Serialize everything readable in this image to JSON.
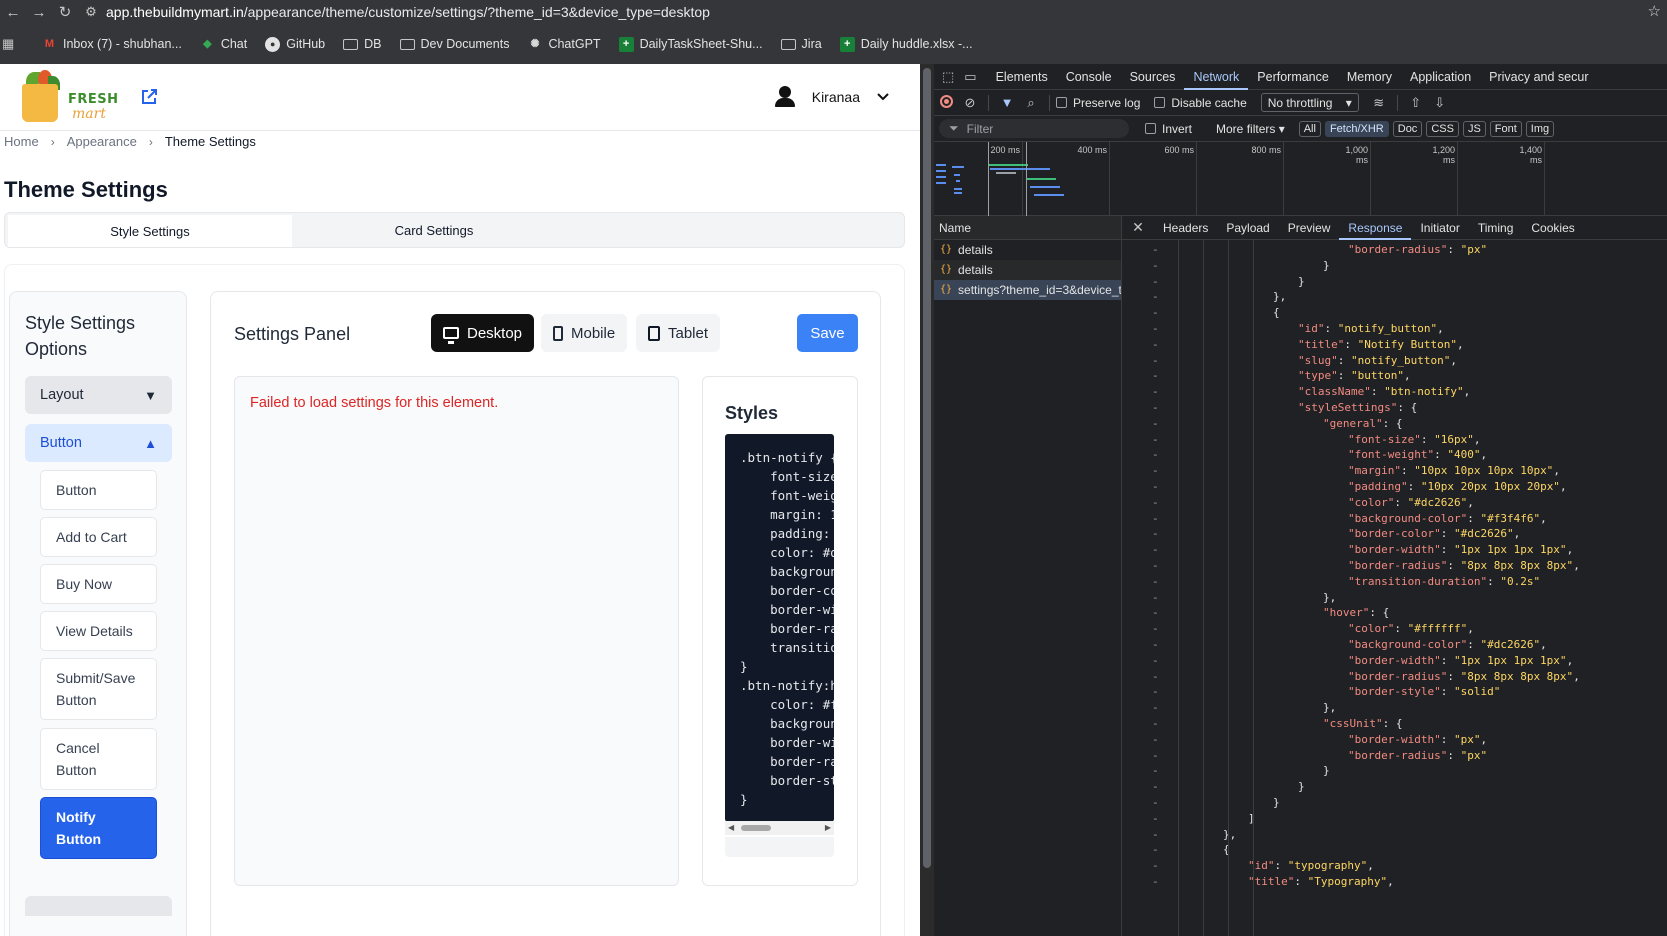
{
  "browser": {
    "url_host": "app.thebuildmymart.in",
    "url_path": "/appearance/theme/customize/settings/?theme_id=3&device_type=desktop",
    "bookmarks": [
      {
        "label": "Inbox (7) - shubhan...",
        "icon": "gmail-icon"
      },
      {
        "label": "Chat",
        "icon": "chat-icon"
      },
      {
        "label": "GitHub",
        "icon": "github-icon"
      },
      {
        "label": "DB",
        "icon": "folder-icon"
      },
      {
        "label": "Dev Documents",
        "icon": "folder-icon"
      },
      {
        "label": "ChatGPT",
        "icon": "chatgpt-icon"
      },
      {
        "label": "DailyTaskSheet-Shu...",
        "icon": "sheets-icon"
      },
      {
        "label": "Jira",
        "icon": "folder-icon"
      },
      {
        "label": "Daily huddle.xlsx -...",
        "icon": "sheets-icon"
      }
    ]
  },
  "app": {
    "logo_line1": "FRESH",
    "logo_line2": "mart",
    "user_name": "Kiranaa",
    "breadcrumb": [
      "Home",
      "Appearance",
      "Theme Settings"
    ],
    "page_title": "Theme Settings",
    "tabs": [
      "Style Settings",
      "Card Settings"
    ],
    "sidebar": {
      "title": "Style Settings Options",
      "sections": [
        {
          "label": "Layout",
          "expanded": false
        },
        {
          "label": "Button",
          "expanded": true
        }
      ],
      "items": [
        "Button",
        "Add to Cart",
        "Buy Now",
        "View Details",
        "Submit/Save Button",
        "Cancel Button",
        "Notify Button"
      ],
      "selected_item": "Notify Button"
    },
    "panel": {
      "title": "Settings Panel",
      "devices": [
        "Desktop",
        "Mobile",
        "Tablet"
      ],
      "active_device": "Desktop",
      "save_label": "Save",
      "error_message": "Failed to load settings for this element.",
      "styles_title": "Styles",
      "code_lines": [
        ".btn-notify {",
        "    font-size",
        "    font-weig",
        "    margin: 1",
        "    padding:",
        "    color: #d",
        "    backgroun",
        "    border-co",
        "    border-wi",
        "    border-ra",
        "    transitio",
        "}",
        ".btn-notify:h",
        "    color: #f",
        "    backgroun",
        "    border-wi",
        "    border-ra",
        "    border-st",
        "}"
      ]
    }
  },
  "devtools": {
    "main_tabs": [
      "Elements",
      "Console",
      "Sources",
      "Network",
      "Performance",
      "Memory",
      "Application",
      "Privacy and secur"
    ],
    "active_main_tab": "Network",
    "preserve_log": "Preserve log",
    "disable_cache": "Disable cache",
    "throttling": "No throttling",
    "filter_placeholder": "Filter",
    "invert": "Invert",
    "more_filters": "More filters",
    "type_filters": [
      "All",
      "Fetch/XHR",
      "Doc",
      "CSS",
      "JS",
      "Font",
      "Img"
    ],
    "active_type_filter": "Fetch/XHR",
    "timeline_labels": [
      "200 ms",
      "400 ms",
      "600 ms",
      "800 ms",
      "1,000 ms",
      "1,200 ms",
      "1,400 ms"
    ],
    "name_header": "Name",
    "requests": [
      "details",
      "details",
      "settings?theme_id=3&device_t..."
    ],
    "selected_request": "settings?theme_id=3&device_t...",
    "detail_tabs": [
      "Headers",
      "Payload",
      "Preview",
      "Response",
      "Initiator",
      "Timing",
      "Cookies"
    ],
    "active_detail_tab": "Response",
    "response_lines": [
      {
        "indent": 10,
        "text": "\"border-radius\": \"px\""
      },
      {
        "indent": 9,
        "text": "}"
      },
      {
        "indent": 8,
        "text": "}"
      },
      {
        "indent": 7,
        "text": "},"
      },
      {
        "indent": 7,
        "text": "{"
      },
      {
        "indent": 8,
        "text": "\"id\": \"notify_button\","
      },
      {
        "indent": 8,
        "text": "\"title\": \"Notify Button\","
      },
      {
        "indent": 8,
        "text": "\"slug\": \"notify_button\","
      },
      {
        "indent": 8,
        "text": "\"type\": \"button\","
      },
      {
        "indent": 8,
        "text": "\"className\": \"btn-notify\","
      },
      {
        "indent": 8,
        "text": "\"styleSettings\": {"
      },
      {
        "indent": 9,
        "text": "\"general\": {"
      },
      {
        "indent": 10,
        "text": "\"font-size\": \"16px\","
      },
      {
        "indent": 10,
        "text": "\"font-weight\": \"400\","
      },
      {
        "indent": 10,
        "text": "\"margin\": \"10px 10px 10px 10px\","
      },
      {
        "indent": 10,
        "text": "\"padding\": \"10px 20px 10px 20px\","
      },
      {
        "indent": 10,
        "text": "\"color\": \"#dc2626\","
      },
      {
        "indent": 10,
        "text": "\"background-color\": \"#f3f4f6\","
      },
      {
        "indent": 10,
        "text": "\"border-color\": \"#dc2626\","
      },
      {
        "indent": 10,
        "text": "\"border-width\": \"1px 1px 1px 1px\","
      },
      {
        "indent": 10,
        "text": "\"border-radius\": \"8px 8px 8px 8px\","
      },
      {
        "indent": 10,
        "text": "\"transition-duration\": \"0.2s\""
      },
      {
        "indent": 9,
        "text": "},"
      },
      {
        "indent": 9,
        "text": "\"hover\": {"
      },
      {
        "indent": 10,
        "text": "\"color\": \"#ffffff\","
      },
      {
        "indent": 10,
        "text": "\"background-color\": \"#dc2626\","
      },
      {
        "indent": 10,
        "text": "\"border-width\": \"1px 1px 1px 1px\","
      },
      {
        "indent": 10,
        "text": "\"border-radius\": \"8px 8px 8px 8px\","
      },
      {
        "indent": 10,
        "text": "\"border-style\": \"solid\""
      },
      {
        "indent": 9,
        "text": "},"
      },
      {
        "indent": 9,
        "text": "\"cssUnit\": {"
      },
      {
        "indent": 10,
        "text": "\"border-width\": \"px\","
      },
      {
        "indent": 10,
        "text": "\"border-radius\": \"px\""
      },
      {
        "indent": 9,
        "text": "}"
      },
      {
        "indent": 8,
        "text": "}"
      },
      {
        "indent": 7,
        "text": "}"
      },
      {
        "indent": 6,
        "text": "]"
      },
      {
        "indent": 5,
        "text": "},"
      },
      {
        "indent": 5,
        "text": "{"
      },
      {
        "indent": 6,
        "text": "\"id\": \"typography\","
      },
      {
        "indent": 6,
        "text": "\"title\": \"Typography\","
      }
    ]
  },
  "colors": {
    "accent": "#2563eb",
    "save_button": "#3b82f6",
    "error": "#dc2626",
    "devtools_bg": "#202124",
    "json_key": "#f28b82",
    "json_string": "#fdd663"
  }
}
